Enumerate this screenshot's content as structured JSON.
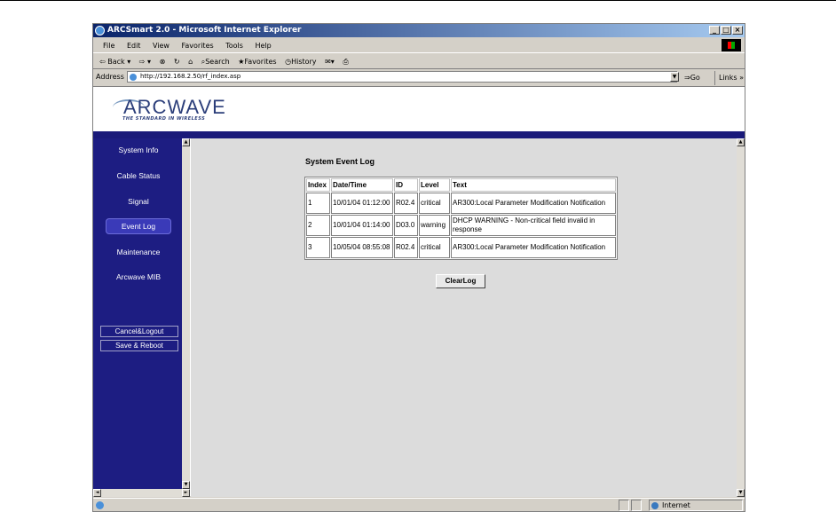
{
  "window": {
    "title": "ARCSmart 2.0 - Microsoft Internet Explorer",
    "minimize": "_",
    "maximize": "□",
    "close": "×"
  },
  "menu": [
    "File",
    "Edit",
    "View",
    "Favorites",
    "Tools",
    "Help"
  ],
  "toolbar": {
    "back": "⇦ Back ▾",
    "forward": "⇨ ▾",
    "stop": "⊗",
    "refresh": "↻",
    "home": "⌂",
    "search": "⌕Search",
    "favorites": "★Favorites",
    "history": "◷History",
    "mail": "✉▾",
    "print": "⎙"
  },
  "address": {
    "label": "Address",
    "value": "http://192.168.2.50/rf_index.asp",
    "go": "⇒Go",
    "links": "Links »"
  },
  "brand": {
    "logo": "ARCWAVE",
    "tagline": "THE STANDARD IN WIRELESS"
  },
  "sidebar": {
    "items": [
      {
        "label": "System Info",
        "active": false
      },
      {
        "label": "Cable Status",
        "active": false
      },
      {
        "label": "Signal",
        "active": false
      },
      {
        "label": "Event Log",
        "active": true
      },
      {
        "label": "Maintenance",
        "active": false
      },
      {
        "label": "Arcwave MIB",
        "active": false
      }
    ],
    "cancel_logout": "Cancel&Logout",
    "save_reboot": "Save & Reboot"
  },
  "main": {
    "title": "System Event Log",
    "columns": [
      "Index",
      "Date/Time",
      "ID",
      "Level",
      "Text"
    ],
    "rows": [
      {
        "index": "1",
        "datetime": "10/01/04 01:12:00",
        "id": "R02.4",
        "level": "critical",
        "text": "AR300:Local Parameter Modification Notification"
      },
      {
        "index": "2",
        "datetime": "10/01/04 01:14:00",
        "id": "D03.0",
        "level": "warning",
        "text": "DHCP WARNING - Non-critical field invalid in response"
      },
      {
        "index": "3",
        "datetime": "10/05/04 08:55:08",
        "id": "R02.4",
        "level": "critical",
        "text": "AR300:Local Parameter Modification Notification"
      }
    ],
    "clear_button": "ClearLog"
  },
  "status": {
    "zone": "Internet"
  }
}
